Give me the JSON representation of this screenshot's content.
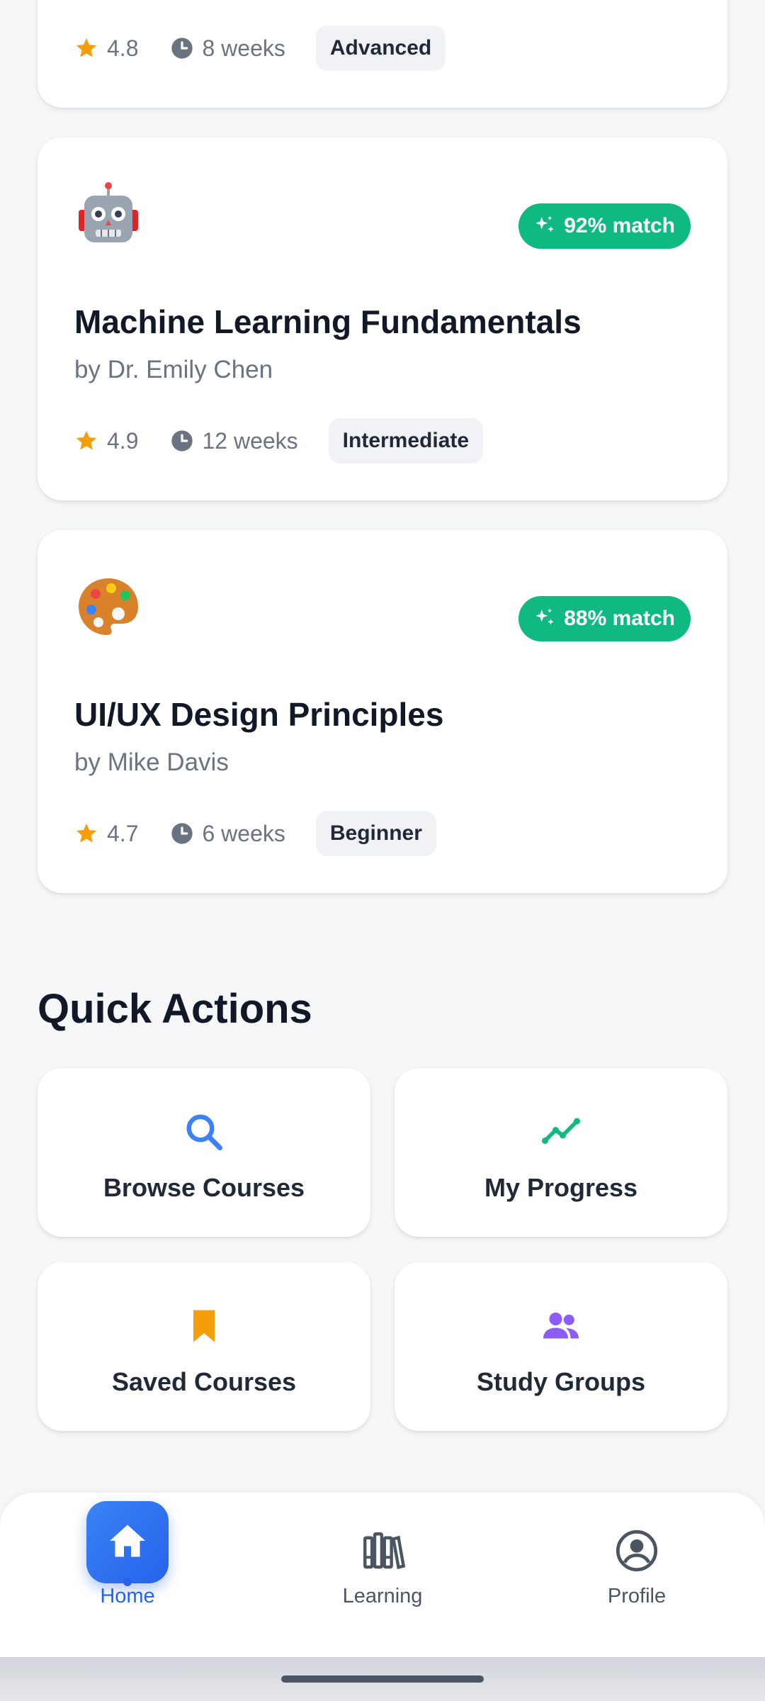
{
  "top_card": {
    "rating": "4.8",
    "duration": "8 weeks",
    "level": "Advanced"
  },
  "recommended_courses": [
    {
      "emoji": "robot",
      "match": "92% match",
      "title": "Machine Learning Fundamentals",
      "author": "by Dr. Emily Chen",
      "rating": "4.9",
      "duration": "12 weeks",
      "level": "Intermediate"
    },
    {
      "emoji": "artist-palette",
      "match": "88% match",
      "title": "UI/UX Design Principles",
      "author": "by Mike Davis",
      "rating": "4.7",
      "duration": "6 weeks",
      "level": "Beginner"
    }
  ],
  "quick_actions": {
    "title": "Quick Actions",
    "items": [
      {
        "label": "Browse Courses",
        "icon": "search-icon",
        "color": "#3b82f6"
      },
      {
        "label": "My Progress",
        "icon": "trending-up-icon",
        "color": "#10b981"
      },
      {
        "label": "Saved Courses",
        "icon": "bookmark-icon",
        "color": "#f59e0b"
      },
      {
        "label": "Study Groups",
        "icon": "users-icon",
        "color": "#8b5cf6"
      }
    ]
  },
  "bottom_nav": {
    "active": "Home",
    "items": [
      {
        "label": "Home",
        "icon": "home-icon"
      },
      {
        "label": "Learning",
        "icon": "library-icon"
      },
      {
        "label": "Profile",
        "icon": "user-circle-icon"
      }
    ]
  },
  "colors": {
    "accent": "#2563eb",
    "match_badge": "#10b981",
    "star": "#f59e0b",
    "background": "#f6f7f9"
  }
}
